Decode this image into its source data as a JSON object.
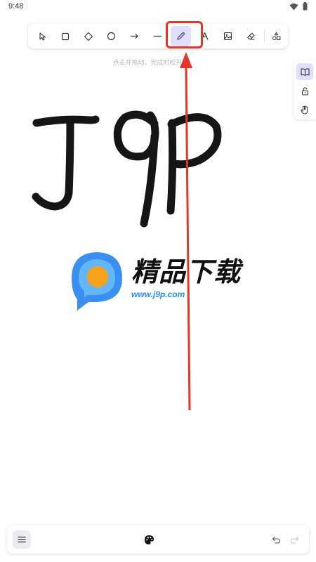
{
  "status_bar": {
    "time": "9:48",
    "icons": [
      "wifi-icon",
      "battery-icon"
    ]
  },
  "toolbar": {
    "tools": [
      {
        "name": "selection",
        "icon": "cursor-icon"
      },
      {
        "name": "rectangle",
        "icon": "square-icon"
      },
      {
        "name": "diamond",
        "icon": "diamond-icon"
      },
      {
        "name": "ellipse",
        "icon": "circle-icon"
      },
      {
        "name": "arrow",
        "icon": "arrow-right-icon"
      },
      {
        "name": "line",
        "icon": "line-icon"
      },
      {
        "name": "draw",
        "icon": "pencil-icon",
        "active": true
      },
      {
        "name": "text",
        "icon": "text-icon"
      },
      {
        "name": "image",
        "icon": "image-icon"
      },
      {
        "name": "eraser",
        "icon": "eraser-icon"
      },
      {
        "name": "more-shapes",
        "icon": "shapes-icon"
      }
    ]
  },
  "canvas": {
    "hint": "点击并拖动，完成时松开",
    "handwriting": "J9P"
  },
  "side_panel": {
    "items": [
      {
        "name": "library",
        "icon": "book-icon",
        "active": true
      },
      {
        "name": "lock",
        "icon": "lock-icon"
      },
      {
        "name": "hand",
        "icon": "hand-icon"
      }
    ]
  },
  "watermark": {
    "title": "精品下载",
    "url": "www.j9p.com"
  },
  "annotation": {
    "color": "#e53529"
  },
  "bottom_bar": {
    "menu_icon": "hamburger-icon",
    "palette_icon": "palette-icon",
    "undo_icon": "undo-icon",
    "redo_icon": "redo-icon"
  },
  "colors": {
    "accent": "#e0dfff",
    "annotation_red": "#e53529",
    "watermark_blue": "#2c8cf2"
  }
}
